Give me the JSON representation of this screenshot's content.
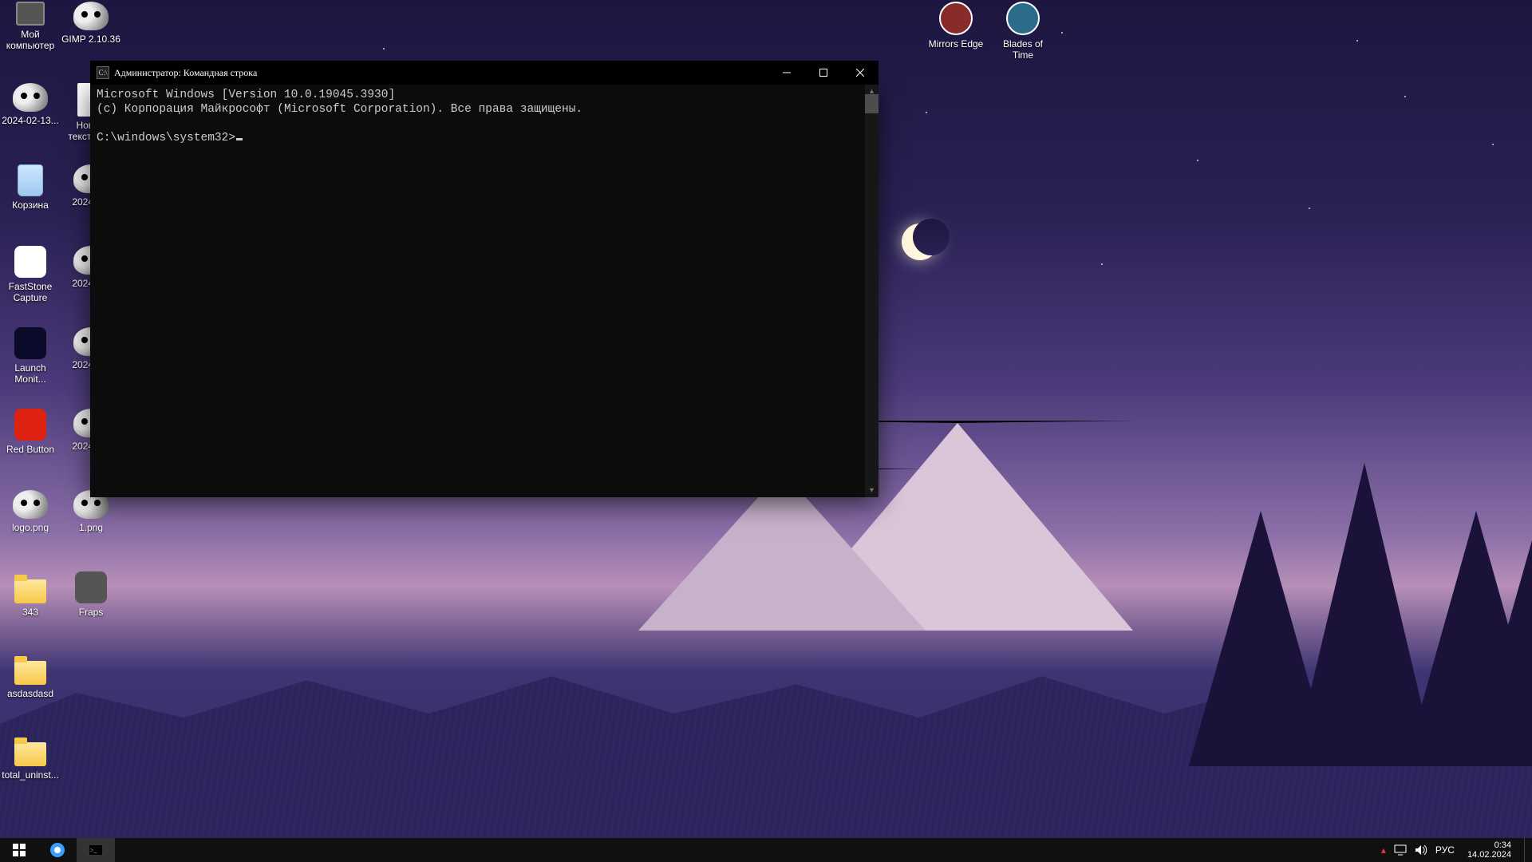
{
  "desktop_icons": {
    "col1": [
      {
        "name": "my-computer",
        "label": "Мой компьютер",
        "kind": "pc"
      },
      {
        "name": "file-2024-02-13",
        "label": "2024-02-13...",
        "kind": "gimp"
      },
      {
        "name": "recycle-bin",
        "label": "Корзина",
        "kind": "bin"
      },
      {
        "name": "faststone-capture",
        "label": "FastStone Capture",
        "kind": "square",
        "bg": "#fff"
      },
      {
        "name": "launch-monitor",
        "label": "Launch Monit...",
        "kind": "square",
        "bg": "#0a0a2a"
      },
      {
        "name": "red-button",
        "label": "Red Button",
        "kind": "square",
        "bg": "#d21"
      },
      {
        "name": "logo-png",
        "label": "logo.png",
        "kind": "gimp"
      },
      {
        "name": "folder-343",
        "label": "343",
        "kind": "folder"
      },
      {
        "name": "folder-asdasdasd",
        "label": "asdasdasd",
        "kind": "folder"
      },
      {
        "name": "folder-total-uninst",
        "label": "total_uninst...",
        "kind": "folder"
      }
    ],
    "col2": [
      {
        "name": "gimp",
        "label": "GIMP 2.10.36",
        "kind": "gimp"
      },
      {
        "name": "new-text-doc",
        "label": "Новый текстовый",
        "kind": "file"
      },
      {
        "name": "file-2024-a",
        "label": "2024-0...",
        "kind": "gimp"
      },
      {
        "name": "file-2024-b",
        "label": "2024-0...",
        "kind": "gimp"
      },
      {
        "name": "file-2024-c",
        "label": "2024-0...",
        "kind": "gimp"
      },
      {
        "name": "file-2024-d",
        "label": "2024-0...",
        "kind": "gimp"
      },
      {
        "name": "one-png",
        "label": "1.png",
        "kind": "gimp"
      },
      {
        "name": "fraps",
        "label": "Fraps",
        "kind": "square",
        "bg": "#555"
      }
    ],
    "right": [
      {
        "name": "mirrors-edge",
        "label": "Mirrors Edge",
        "kind": "round",
        "bg": "#8a2b2b"
      },
      {
        "name": "blades-of-time",
        "label": "Blades of Time",
        "kind": "round",
        "bg": "#2b6c8a"
      }
    ]
  },
  "cmd": {
    "title": "Администратор: Командная строка",
    "line1": "Microsoft Windows [Version 10.0.19045.3930]",
    "line2": "(c) Корпорация Майкрософт (Microsoft Corporation). Все права защищены.",
    "prompt": "C:\\windows\\system32>"
  },
  "taskbar": {
    "lang": "РУС",
    "time": "0:34",
    "date": "14.02.2024"
  }
}
